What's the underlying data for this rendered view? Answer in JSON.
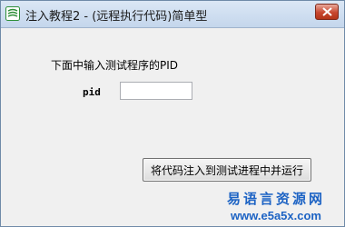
{
  "window": {
    "title": "注入教程2 - (远程执行代码)简单型"
  },
  "main": {
    "prompt": "下面中输入测试程序的PID",
    "pid_label": "pid",
    "pid_value": "",
    "inject_button_label": "将代码注入到测试进程中并运行"
  },
  "watermark": {
    "text": "易语言资源网",
    "url": "www.e5a5x.com"
  },
  "icons": {
    "app": "app-icon",
    "close": "close-icon"
  },
  "colors": {
    "close_button": "#c8472f",
    "watermark": "#1d63c4"
  }
}
